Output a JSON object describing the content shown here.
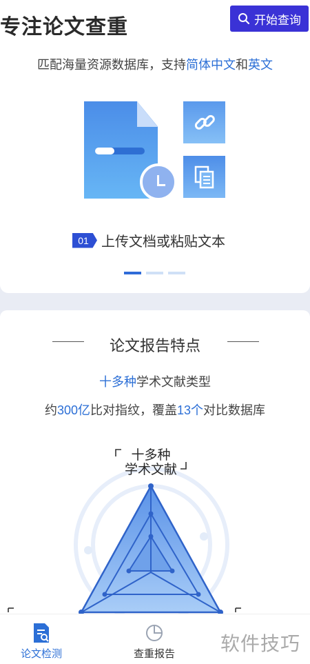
{
  "header": {
    "title": "专注论文查重",
    "search_button": "开始查询"
  },
  "intro": {
    "subtitle_prefix": "匹配海量资源数据库，支持",
    "subtitle_hl1": "简体中文",
    "subtitle_mid": "和",
    "subtitle_hl2": "英文"
  },
  "step": {
    "number": "01",
    "text": "上传文档或粘贴文本"
  },
  "carousel": {
    "active_index": 0,
    "count": 3
  },
  "features": {
    "section_title": "论文报告特点",
    "line1_hl": "十多种",
    "line1_rest": "学术文献类型",
    "line2_a": "约",
    "line2_hl1": "300亿",
    "line2_b": "比对指纹，覆盖",
    "line2_hl2": "13个",
    "line2_c": "对比数据库"
  },
  "radar": {
    "label_top_line1": "十多种",
    "label_top_line2": "学术文献"
  },
  "tabbar": {
    "tab1": "论文检测",
    "tab2": "查重报告"
  },
  "watermark": "软件技巧",
  "colors": {
    "accent": "#2c6fd6",
    "button": "#3a32d6"
  }
}
